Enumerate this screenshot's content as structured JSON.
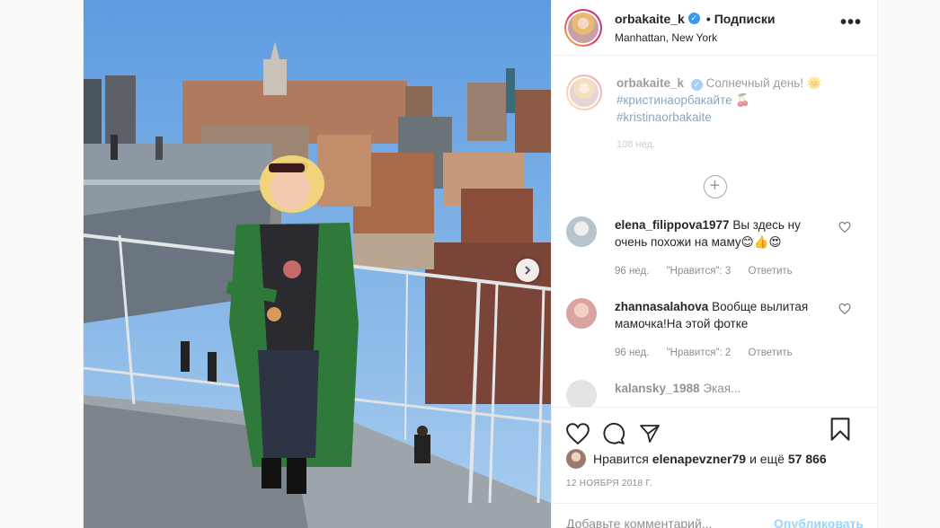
{
  "header": {
    "username": "orbakaite_k",
    "separator": "•",
    "follow_label": "Подписки",
    "location": "Manhattan, New York",
    "more": "•••"
  },
  "caption": {
    "username": "orbakaite_k",
    "text": "Солнечный день! 🌞",
    "tag1": "#кристинаорбакайте 🍒",
    "tag2": "#kristinaorbakaite",
    "age": "108 нед."
  },
  "load_more": "+",
  "comments": [
    {
      "username": "elena_filippova1977",
      "text": "Вы здесь ну очень похожи на маму😊👍😍",
      "age": "96 нед.",
      "likes": "\"Нравится\": 3",
      "reply": "Ответить"
    },
    {
      "username": "zhannasalahova",
      "text": "Вообще вылитая мамочка!На этой фотке",
      "age": "96 нед.",
      "likes": "\"Нравится\": 2",
      "reply": "Ответить"
    },
    {
      "username": "kalansky_1988",
      "text": "Экая..."
    }
  ],
  "likes_line": {
    "prefix": "Нравится",
    "user": "elenapevzner79",
    "middle": "и ещё",
    "count": "57 866"
  },
  "date": "12 ноября 2018 г.",
  "add_comment": {
    "placeholder": "Добавьте комментарий...",
    "publish": "Опубликовать"
  },
  "icons": [
    "heart-icon",
    "comment-icon",
    "share-icon",
    "bookmark-icon",
    "verified-icon",
    "next-arrow-icon",
    "plus-circle-icon",
    "more-icon"
  ],
  "colors": {
    "verified": "#3897f0",
    "link": "#00376b",
    "muted": "#8e8e8e",
    "publish": "#0095f6"
  }
}
